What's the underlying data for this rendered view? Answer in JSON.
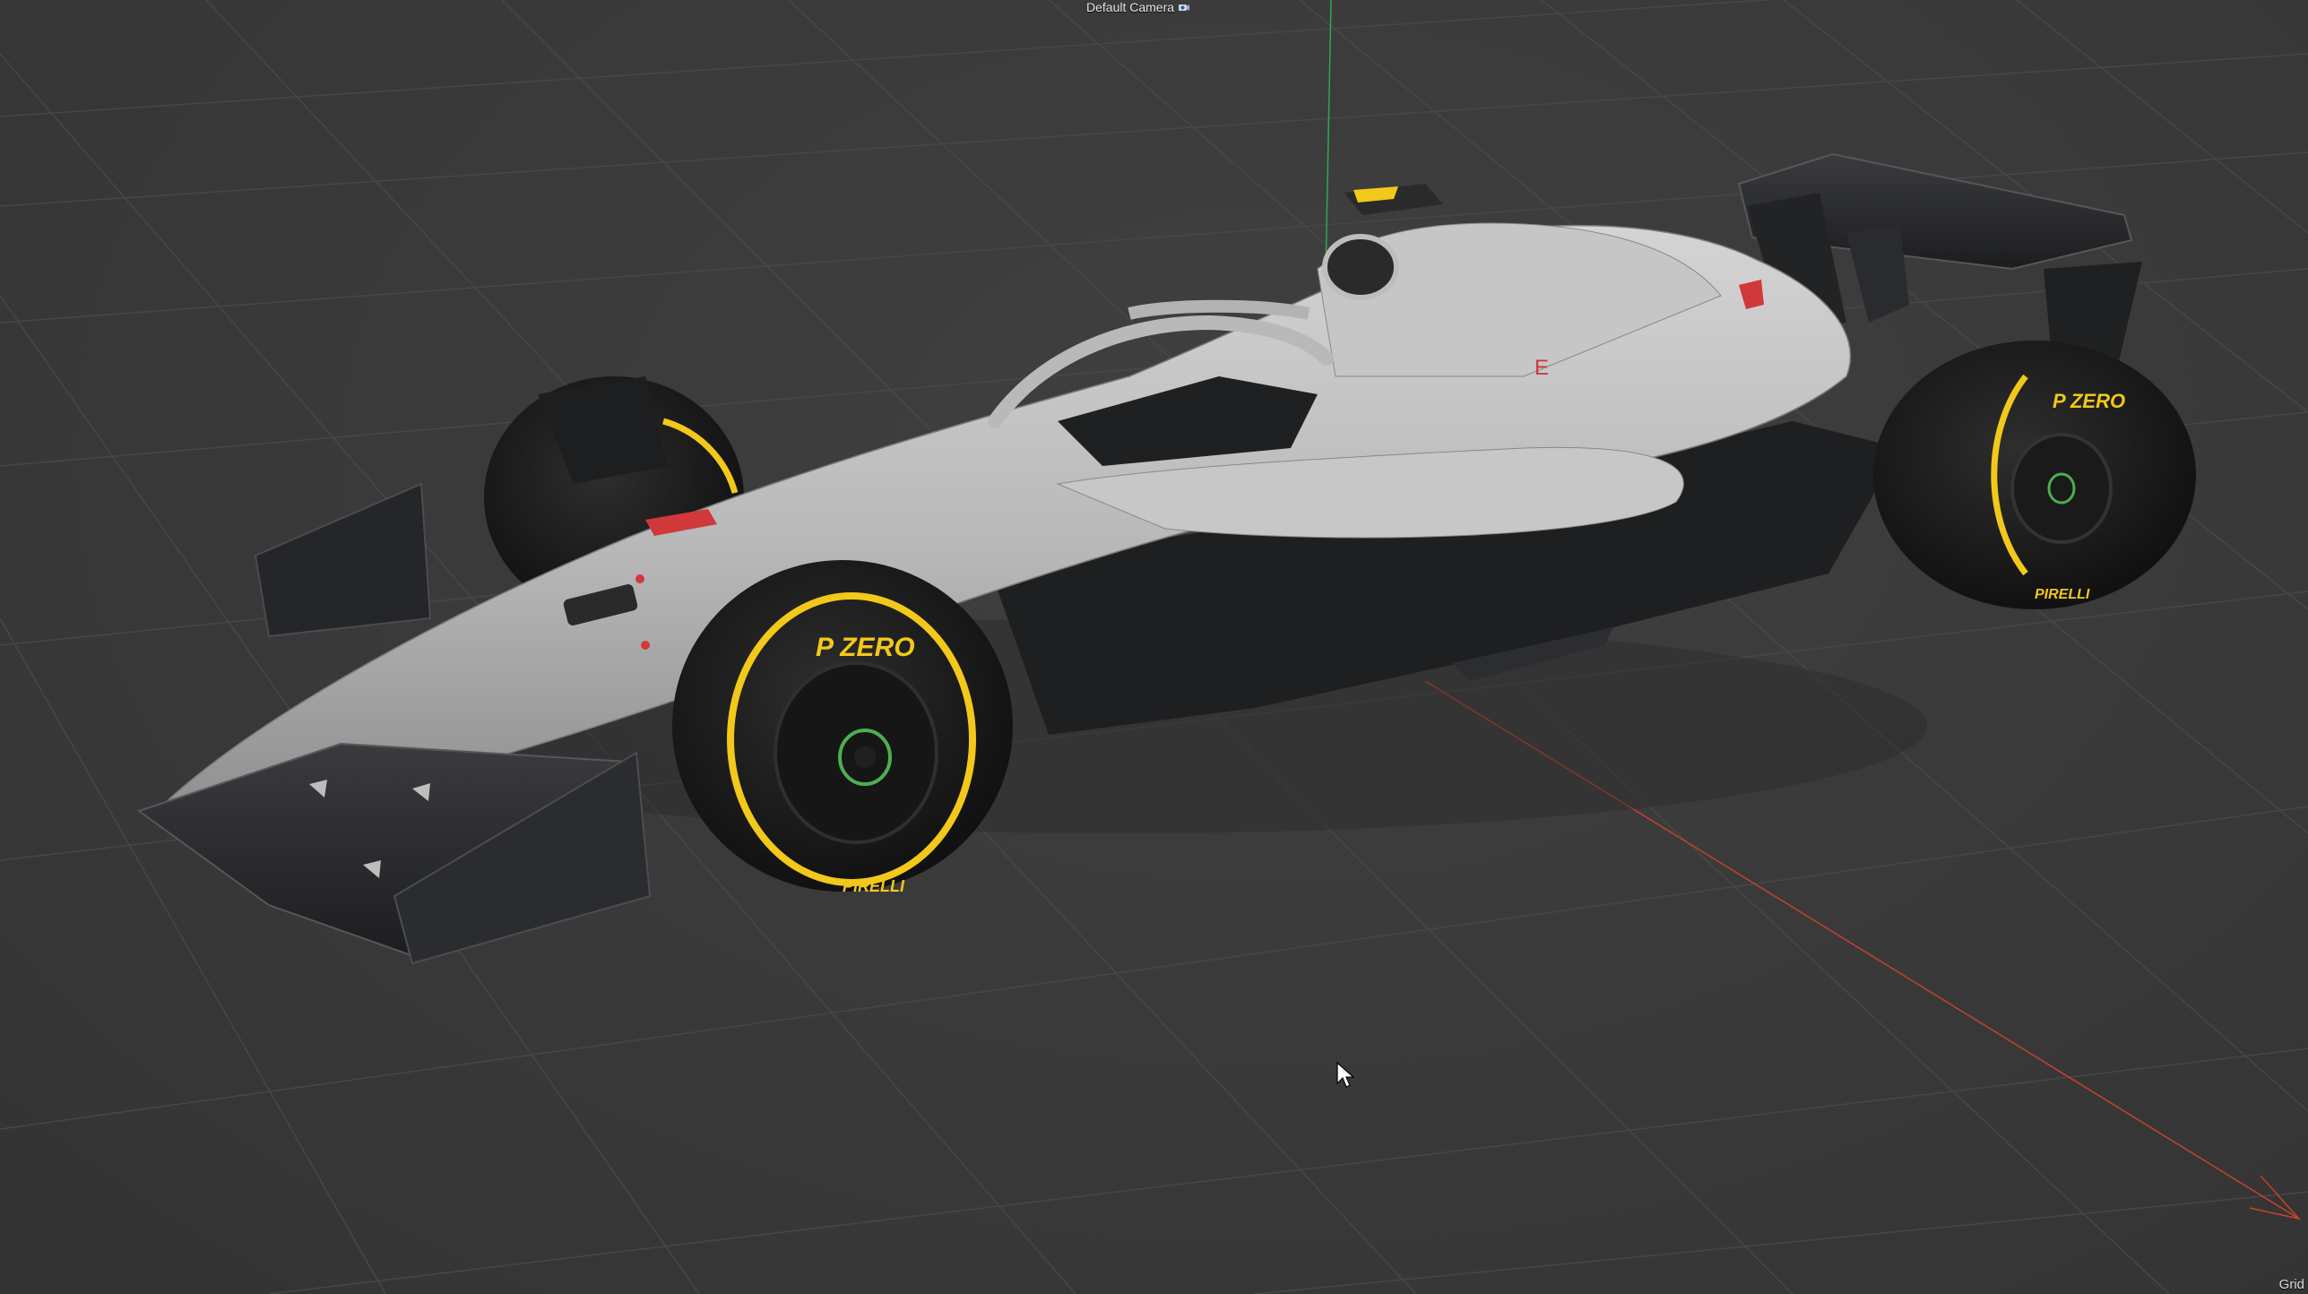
{
  "viewport": {
    "camera_label": "Default Camera",
    "camera_icon": "camera-options-icon",
    "grid_label": "Grid",
    "background_color": "#3a3a3a",
    "grid_line_color": "#454545",
    "axis_colors": {
      "x": "#c8402e",
      "y": "#2fa850"
    }
  },
  "model": {
    "tyre_text": "P ZERO",
    "tyre_brand": "PIRELLI",
    "tyre_accent_color": "#f2c81a",
    "body_color": "#bcbcbc",
    "carbon_color": "#262729",
    "livery_red": "#d0383c"
  }
}
